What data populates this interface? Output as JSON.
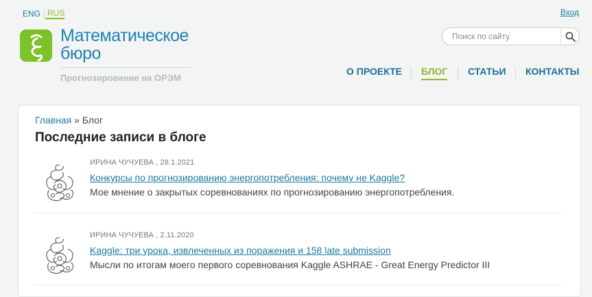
{
  "lang": {
    "eng": "ENG",
    "rus": "RUS"
  },
  "login": "Вход",
  "brand": {
    "line1": "Математическое",
    "line2": "бюро",
    "subtitle": "Прогнозирование на ОРЭМ"
  },
  "search": {
    "placeholder": "Поиск по сайту"
  },
  "nav": {
    "about": "О ПРОЕКТЕ",
    "blog": "БЛОГ",
    "articles": "СТАТЬИ",
    "contacts": "КОНТАКТЫ"
  },
  "breadcrumb": {
    "home": "Главная",
    "separator": " » ",
    "current": "Блог"
  },
  "heading": "Последние записи в блоге",
  "posts": [
    {
      "meta": "ИРИНА ЧУЧУЕВА , 28.1.2021",
      "title": "Конкурсы по прогнозированию энергопотребления: почему не Kaggle?",
      "desc": "Мое мнение о закрытых соревнованиях по прогнозированию энергопотребления."
    },
    {
      "meta": "ИРИНА ЧУЧУЕВА , 2.11.2020",
      "title": "Kaggle: три урока, извлеченных из поражения и 158 late submission",
      "desc": "Мысли по итогам моего первого соревнования Kaggle ASHRAE - Great Energy Predictor III"
    }
  ],
  "colors": {
    "accent": "#8dbb28",
    "link": "#1a7aa0",
    "brand": "#2182b2",
    "logo": "#7cc22a"
  },
  "icons": {
    "search": "search-icon",
    "logo": "logo-xi-icon",
    "thumb": "author-avatar-icon"
  }
}
